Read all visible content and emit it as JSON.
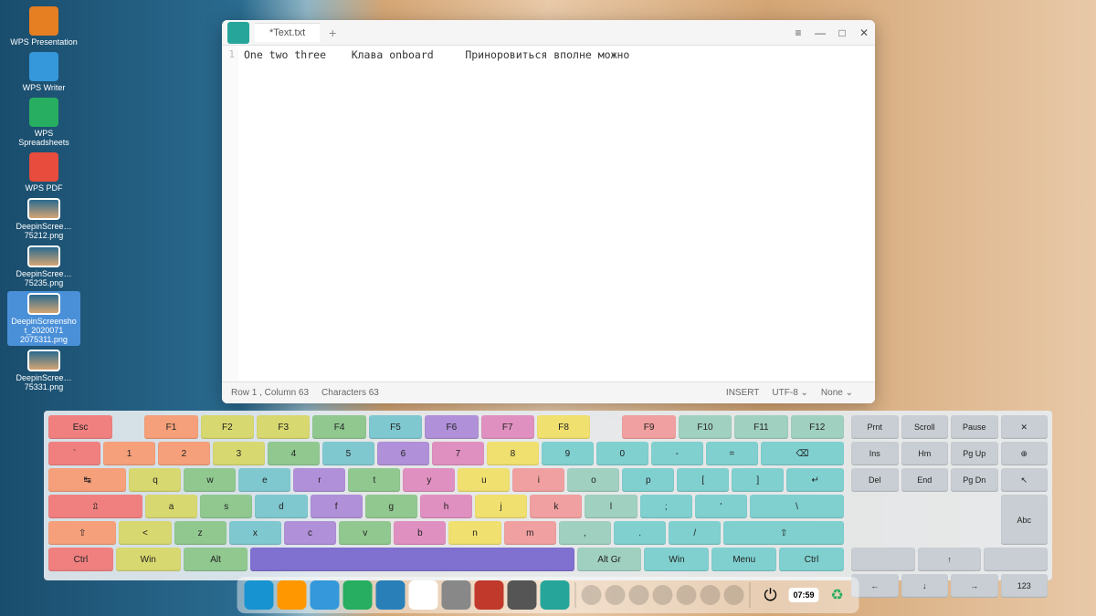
{
  "desktop_icons": [
    {
      "label": "WPS Presentation",
      "color": "#e67e22"
    },
    {
      "label": "WPS Writer",
      "color": "#3498db"
    },
    {
      "label": "WPS Spreadsheets",
      "color": "#27ae60"
    },
    {
      "label": "WPS PDF",
      "color": "#e74c3c"
    },
    {
      "label": "DeepinScree…75212.png",
      "color": "#555",
      "thumb": true
    },
    {
      "label": "DeepinScree…75235.png",
      "color": "#555",
      "thumb": true
    },
    {
      "label": "DeepinScreenshot_2020071 2075311.png",
      "color": "#4a90d9",
      "thumb": true,
      "selected": true
    },
    {
      "label": "DeepinScree…75331.png",
      "color": "#555",
      "thumb": true
    }
  ],
  "editor": {
    "tab": "*Text.txt",
    "line_no": "1",
    "content": "One two three    Клава onboard     Приноровиться вполне можно",
    "status_pos": "Row 1 , Column 63",
    "status_chars": "Characters 63",
    "status_mode": "INSERT",
    "status_enc": "UTF-8 ⌄",
    "status_lang": "None ⌄"
  },
  "kb": {
    "r0": [
      {
        "l": "Esc",
        "c": "#f08080",
        "w": 1.2
      },
      {
        "g": 0.5
      },
      {
        "l": "F1",
        "c": "#f5a07a"
      },
      {
        "l": "F2",
        "c": "#d8d870"
      },
      {
        "l": "F3",
        "c": "#d8d870"
      },
      {
        "l": "F4",
        "c": "#90c890"
      },
      {
        "l": "F5",
        "c": "#80c8d0"
      },
      {
        "l": "F6",
        "c": "#b090d8"
      },
      {
        "l": "F7",
        "c": "#e090c0"
      },
      {
        "l": "F8",
        "c": "#f0e070"
      },
      {
        "g": 0.5
      },
      {
        "l": "F9",
        "c": "#f0a0a0"
      },
      {
        "l": "F10",
        "c": "#a0d0c0"
      },
      {
        "l": "F11",
        "c": "#a0d0c0"
      },
      {
        "l": "F12",
        "c": "#a0d0c0"
      }
    ],
    "r1": [
      {
        "l": "`",
        "c": "#f08080"
      },
      {
        "l": "1",
        "c": "#f5a07a"
      },
      {
        "l": "2",
        "c": "#f5a07a"
      },
      {
        "l": "3",
        "c": "#d8d870"
      },
      {
        "l": "4",
        "c": "#90c890"
      },
      {
        "l": "5",
        "c": "#80c8d0"
      },
      {
        "l": "6",
        "c": "#b090d8"
      },
      {
        "l": "7",
        "c": "#e090c0"
      },
      {
        "l": "8",
        "c": "#f0e070"
      },
      {
        "l": "9",
        "c": "#80d0d0"
      },
      {
        "l": "0",
        "c": "#80d0d0"
      },
      {
        "l": "-",
        "c": "#80d0d0"
      },
      {
        "l": "=",
        "c": "#80d0d0"
      },
      {
        "l": "⌫",
        "c": "#80d0d0",
        "w": 1.6
      }
    ],
    "r2": [
      {
        "l": "↹",
        "c": "#f5a07a",
        "w": 1.5
      },
      {
        "l": "q",
        "c": "#d8d870"
      },
      {
        "l": "w",
        "c": "#90c890"
      },
      {
        "l": "e",
        "c": "#80c8d0"
      },
      {
        "l": "r",
        "c": "#b090d8"
      },
      {
        "l": "t",
        "c": "#90c890"
      },
      {
        "l": "y",
        "c": "#e090c0"
      },
      {
        "l": "u",
        "c": "#f0e070"
      },
      {
        "l": "i",
        "c": "#f0a0a0"
      },
      {
        "l": "o",
        "c": "#a0d0c0"
      },
      {
        "l": "p",
        "c": "#80d0d0"
      },
      {
        "l": "[",
        "c": "#80d0d0"
      },
      {
        "l": "]",
        "c": "#80d0d0"
      },
      {
        "l": "↵",
        "c": "#80d0d0",
        "w": 1.1
      }
    ],
    "r3": [
      {
        "l": "⇫",
        "c": "#f08080",
        "w": 1.8
      },
      {
        "l": "a",
        "c": "#d8d870"
      },
      {
        "l": "s",
        "c": "#90c890"
      },
      {
        "l": "d",
        "c": "#80c8d0"
      },
      {
        "l": "f",
        "c": "#b090d8"
      },
      {
        "l": "g",
        "c": "#90c890"
      },
      {
        "l": "h",
        "c": "#e090c0"
      },
      {
        "l": "j",
        "c": "#f0e070"
      },
      {
        "l": "k",
        "c": "#f0a0a0"
      },
      {
        "l": "l",
        "c": "#a0d0c0"
      },
      {
        "l": ";",
        "c": "#80d0d0"
      },
      {
        "l": "'",
        "c": "#80d0d0"
      },
      {
        "l": "\\",
        "c": "#80d0d0",
        "w": 1.8
      }
    ],
    "r4": [
      {
        "l": "⇧",
        "c": "#f5a07a",
        "w": 1.3
      },
      {
        "l": "<",
        "c": "#d8d870"
      },
      {
        "l": "z",
        "c": "#90c890"
      },
      {
        "l": "x",
        "c": "#80c8d0"
      },
      {
        "l": "c",
        "c": "#b090d8"
      },
      {
        "l": "v",
        "c": "#90c890"
      },
      {
        "l": "b",
        "c": "#e090c0"
      },
      {
        "l": "n",
        "c": "#f0e070"
      },
      {
        "l": "m",
        "c": "#f0a0a0"
      },
      {
        "l": ",",
        "c": "#a0d0c0"
      },
      {
        "l": ".",
        "c": "#80d0d0"
      },
      {
        "l": "/",
        "c": "#80d0d0"
      },
      {
        "l": "⇧",
        "c": "#80d0d0",
        "w": 2.3
      }
    ],
    "r5": [
      {
        "l": "Ctrl",
        "c": "#f08080",
        "w": 1.3
      },
      {
        "l": "Win",
        "c": "#d8d870",
        "w": 1.3
      },
      {
        "l": "Alt",
        "c": "#90c890",
        "w": 1.3
      },
      {
        "l": "",
        "c": "#8070d0",
        "w": 6.5
      },
      {
        "l": "Alt Gr",
        "c": "#a0d0c0",
        "w": 1.3
      },
      {
        "l": "Win",
        "c": "#80d0d0",
        "w": 1.3
      },
      {
        "l": "Menu",
        "c": "#80d0d0",
        "w": 1.3
      },
      {
        "l": "Ctrl",
        "c": "#80d0d0",
        "w": 1.3
      }
    ],
    "side": [
      [
        {
          "l": "Prnt"
        },
        {
          "l": "Scroll"
        },
        {
          "l": "Pause"
        },
        {
          "l": "✕"
        }
      ],
      [
        {
          "l": "Ins"
        },
        {
          "l": "Hm"
        },
        {
          "l": "Pg Up"
        },
        {
          "l": "⊕"
        }
      ],
      [
        {
          "l": "Del"
        },
        {
          "l": "End"
        },
        {
          "l": "Pg Dn"
        },
        {
          "l": "↖"
        }
      ],
      [
        {
          "l": ""
        },
        {
          "l": ""
        },
        {
          "l": ""
        },
        {
          "l": "Abc",
          "h": 2
        }
      ],
      [
        {
          "l": ""
        },
        {
          "l": "↑"
        },
        {
          "l": ""
        }
      ],
      [
        {
          "l": "←"
        },
        {
          "l": "↓"
        },
        {
          "l": "→"
        },
        {
          "l": "123"
        }
      ]
    ]
  },
  "taskbar": {
    "time": "07:59",
    "icons": [
      "launcher",
      "files",
      "store",
      "music",
      "video",
      "chrome",
      "settings",
      "terminal",
      "keyboard",
      "editor"
    ]
  }
}
